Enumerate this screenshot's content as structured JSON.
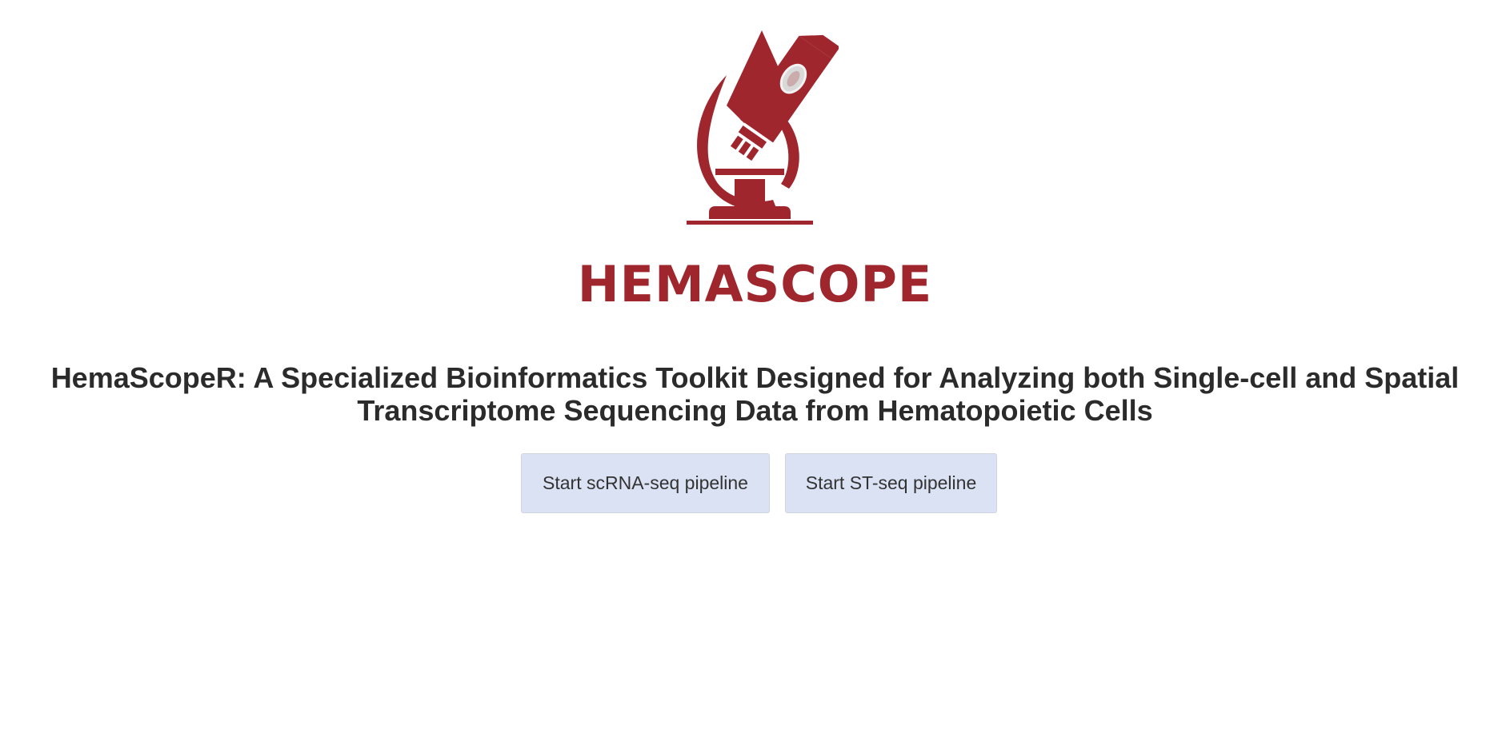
{
  "logo": {
    "icon": "microscope-icon",
    "text": "HEMASCOPE",
    "color": "#a0262d"
  },
  "title": "HemaScopeR: A Specialized Bioinformatics Toolkit Designed for Analyzing both Single-cell and Spatial Transcriptome Sequencing Data from Hematopoietic Cells",
  "buttons": {
    "scrna": "Start scRNA-seq pipeline",
    "stseq": "Start ST-seq pipeline",
    "background": "#dae2f4"
  }
}
